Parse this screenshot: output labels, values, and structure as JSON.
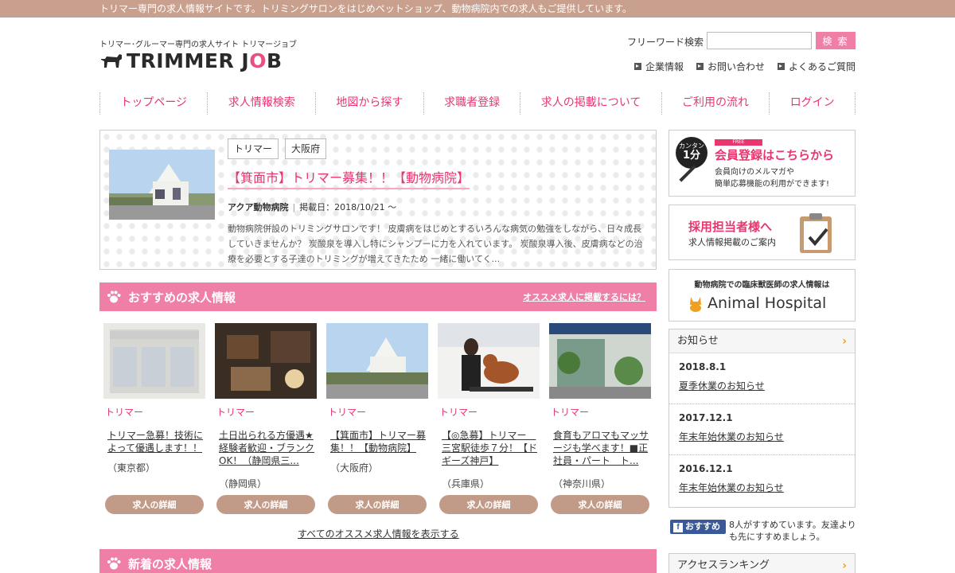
{
  "topbar_text": "トリマー専門の求人情報サイトです。トリミングサロンをはじめペットショップ、動物病院内での求人もご提供しています。",
  "logo": {
    "tagline": "トリマー･グルーマー専門の求人サイト トリマージョブ",
    "text_a": "TRIMMER J",
    "text_o": "O",
    "text_b": "B"
  },
  "search": {
    "label": "フリーワード検索",
    "placeholder": "",
    "button": "検 索"
  },
  "util_links": [
    "企業情報",
    "お問い合わせ",
    "よくあるご質問"
  ],
  "nav": [
    "トップページ",
    "求人情報検索",
    "地図から探す",
    "求職者登録",
    "求人の掲載について",
    "ご利用の流れ",
    "ログイン"
  ],
  "feature": {
    "tags": [
      "トリマー",
      "大阪府"
    ],
    "title": "【箕面市】トリマー募集！！【動物病院】",
    "company": "アクア動物病院",
    "posted": "掲載日：2018/10/21 ～",
    "description": "動物病院併設のトリミングサロンです！ 皮膚病をはじめとするいろんな病気の勉強をしながら、日々成長していきませんか？ 炭酸泉を導入し特にシャンプーに力を入れています。 炭酸泉導入後、皮膚病などの治療を必要とする子達のトリミングが増えてきたため 一緒に働いてく..."
  },
  "recommended": {
    "title": "おすすめの求人情報",
    "link": "オススメ求人に掲載するには？",
    "cards": [
      {
        "category": "トリマー",
        "title": "トリマー急募！技術によって優遇します！！",
        "location": "（東京都）",
        "button": "求人の詳細"
      },
      {
        "category": "トリマー",
        "title": "土日出られる方優遇★経験者歓迎・ブランクOK！（静岡県三...",
        "location": "（静岡県）",
        "button": "求人の詳細"
      },
      {
        "category": "トリマー",
        "title": "【箕面市】トリマー募集！！【動物病院】",
        "location": "（大阪府）",
        "button": "求人の詳細"
      },
      {
        "category": "トリマー",
        "title": "【◎急募】トリマー　三宮駅徒歩７分！【ドギーズ神戸】",
        "location": "（兵庫県）",
        "button": "求人の詳細"
      },
      {
        "category": "トリマー",
        "title": "食育もアロマもマッサージも学べます！■正社員・パート　ト...",
        "location": "（神奈川県）",
        "button": "求人の詳細"
      }
    ],
    "all_link": "すべてのオススメ求人情報を表示する"
  },
  "new_jobs": {
    "title": "新着の求人情報"
  },
  "side": {
    "register": {
      "badge_small": "カンタン",
      "badge_big": "1分",
      "free": "FREE",
      "title": "会員登録はこちらから",
      "sub1": "会員向けのメルマガや",
      "sub2": "簡単応募機能の利用ができます!"
    },
    "recruiter": {
      "title": "採用担当者様へ",
      "sub": "求人情報掲載のご案内"
    },
    "hospital": {
      "sub": "動物病院での臨床獣医師の求人情報は",
      "title": "Animal Hospital"
    },
    "news": {
      "heading": "お知らせ",
      "items": [
        {
          "date": "2018.8.1",
          "title": "夏季休業のお知らせ"
        },
        {
          "date": "2017.12.1",
          "title": "年末年始休業のお知らせ"
        },
        {
          "date": "2016.12.1",
          "title": "年末年始休業のお知らせ"
        }
      ]
    },
    "fb": {
      "button": "おすすめ",
      "text": "8人がすすめています。友達よりも先にすすめましょう。"
    },
    "ranking": "アクセスランキング"
  },
  "colors": {
    "topbar": "#c9a08e",
    "accent_pink": "#e8366e",
    "section_bar": "#f07fa8",
    "button_brown": "#c29b88"
  }
}
